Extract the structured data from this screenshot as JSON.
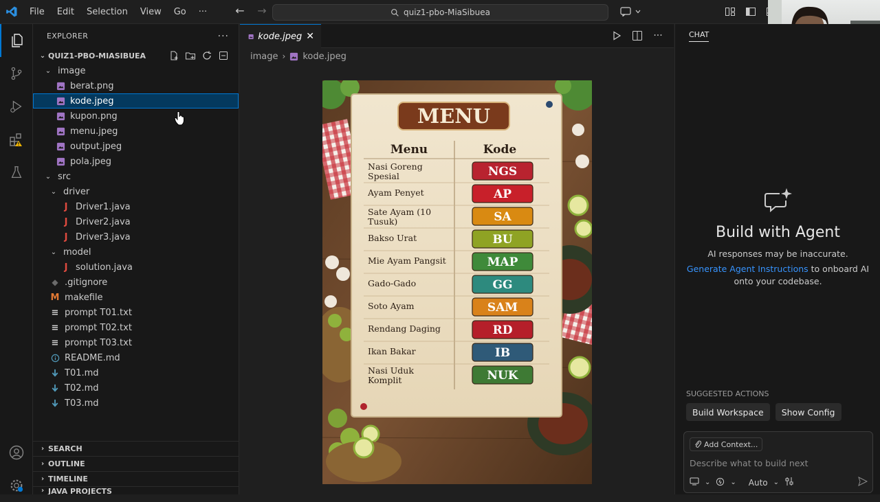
{
  "titlebar": {
    "menu": [
      "File",
      "Edit",
      "Selection",
      "View",
      "Go",
      "···"
    ],
    "search_text": "quiz1-pbo-MiaSibuea"
  },
  "explorer": {
    "header": "EXPLORER",
    "project": "QUIZ1-PBO-MIASIBUEA",
    "tree": [
      {
        "label": "image",
        "depth": 1,
        "kind": "folder"
      },
      {
        "label": "berat.png",
        "depth": 2,
        "kind": "image"
      },
      {
        "label": "kode.jpeg",
        "depth": 2,
        "kind": "image",
        "selected": true
      },
      {
        "label": "kupon.png",
        "depth": 2,
        "kind": "image"
      },
      {
        "label": "menu.jpeg",
        "depth": 2,
        "kind": "image"
      },
      {
        "label": "output.jpeg",
        "depth": 2,
        "kind": "image"
      },
      {
        "label": "pola.jpeg",
        "depth": 2,
        "kind": "image"
      },
      {
        "label": "src",
        "depth": 1,
        "kind": "folder"
      },
      {
        "label": "driver",
        "depth": 2,
        "kind": "folder"
      },
      {
        "label": "Driver1.java",
        "depth": 3,
        "kind": "java"
      },
      {
        "label": "Driver2.java",
        "depth": 3,
        "kind": "java"
      },
      {
        "label": "Driver3.java",
        "depth": 3,
        "kind": "java"
      },
      {
        "label": "model",
        "depth": 2,
        "kind": "folder"
      },
      {
        "label": "solution.java",
        "depth": 3,
        "kind": "java"
      },
      {
        "label": ".gitignore",
        "depth": 1,
        "kind": "git"
      },
      {
        "label": "makefile",
        "depth": 1,
        "kind": "make"
      },
      {
        "label": "prompt T01.txt",
        "depth": 1,
        "kind": "txt"
      },
      {
        "label": "prompt T02.txt",
        "depth": 1,
        "kind": "txt"
      },
      {
        "label": "prompt T03.txt",
        "depth": 1,
        "kind": "txt"
      },
      {
        "label": "README.md",
        "depth": 1,
        "kind": "info"
      },
      {
        "label": "T01.md",
        "depth": 1,
        "kind": "md"
      },
      {
        "label": "T02.md",
        "depth": 1,
        "kind": "md"
      },
      {
        "label": "T03.md",
        "depth": 1,
        "kind": "md"
      }
    ],
    "sections": [
      "SEARCH",
      "OUTLINE",
      "TIMELINE",
      "JAVA PROJECTS"
    ]
  },
  "editor": {
    "tab_label": "kode.jpeg",
    "breadcrumb": [
      "image",
      "kode.jpeg"
    ]
  },
  "menu_image": {
    "title": "MENU",
    "col_menu": "Menu",
    "col_kode": "Kode",
    "rows": [
      {
        "name": "Nasi Goreng Spesial",
        "code": "NGS",
        "color": "#b8232f"
      },
      {
        "name": "Ayam Penyet",
        "code": "AP",
        "color": "#c8202a"
      },
      {
        "name": "Sate Ayam (10 Tusuk)",
        "code": "SA",
        "color": "#d98a12"
      },
      {
        "name": "Bakso Urat",
        "code": "BU",
        "color": "#8fa324"
      },
      {
        "name": "Mie Ayam Pangsit",
        "code": "MAP",
        "color": "#3f8a3a"
      },
      {
        "name": "Gado-Gado",
        "code": "GG",
        "color": "#2d8a7e"
      },
      {
        "name": "Soto Ayam",
        "code": "SAM",
        "color": "#d9821a"
      },
      {
        "name": "Rendang Daging",
        "code": "RD",
        "color": "#b51f2a"
      },
      {
        "name": "Ikan Bakar",
        "code": "IB",
        "color": "#2f5a78"
      },
      {
        "name": "Nasi Uduk Komplit",
        "code": "NUK",
        "color": "#3e7a34"
      }
    ]
  },
  "chat": {
    "title": "CHAT",
    "heading": "Build with Agent",
    "line1": "AI responses may be inaccurate.",
    "link": "Generate Agent Instructions",
    "line2_rest": "to onboard AI",
    "line3": "onto your codebase.",
    "suggested_header": "SUGGESTED ACTIONS",
    "suggestions": [
      "Build Workspace",
      "Show Config"
    ],
    "add_context": "Add Context...",
    "placeholder": "Describe what to build next",
    "mode": "Auto"
  }
}
